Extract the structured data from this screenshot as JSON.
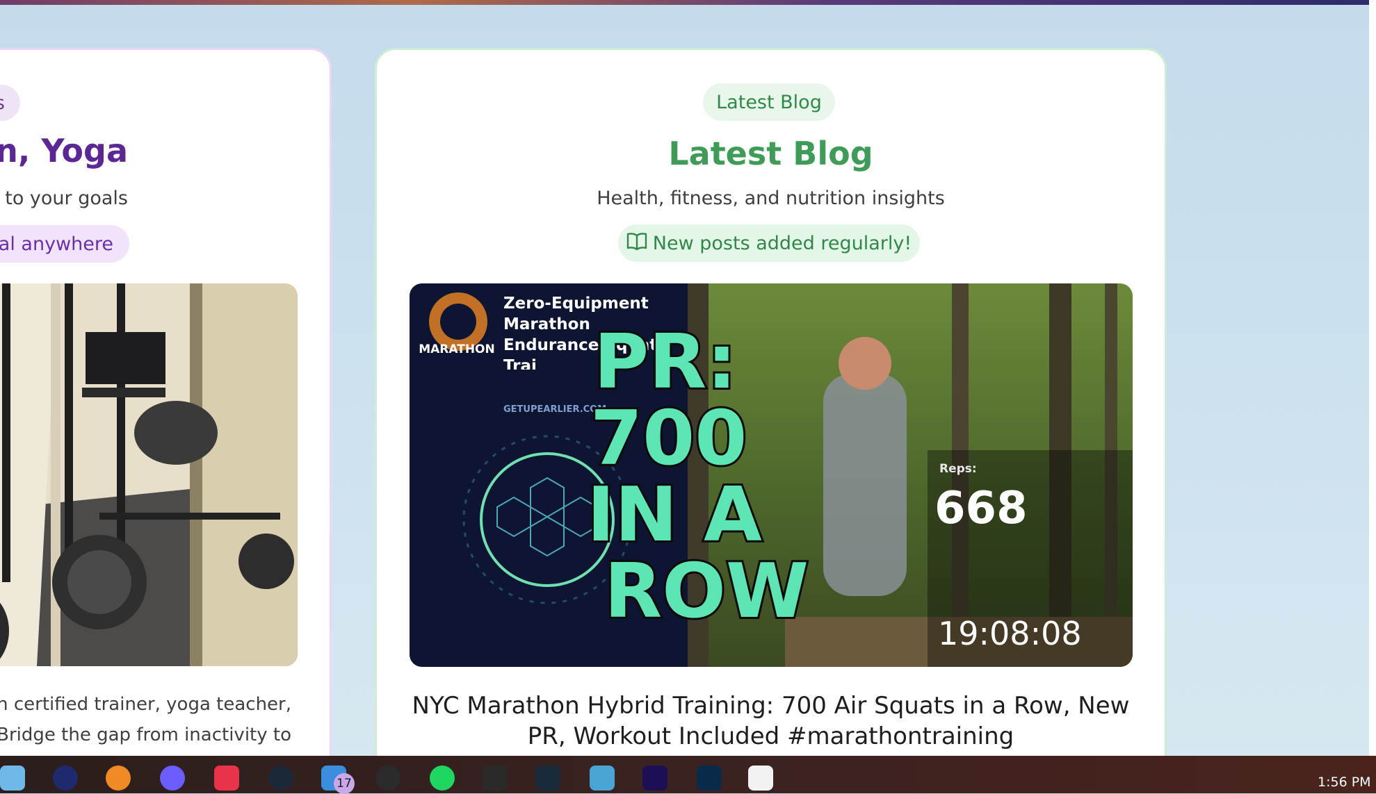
{
  "left_card": {
    "tag_partial": "s",
    "title_partial": "on, Yoga",
    "subtitle_partial": "d to your goals",
    "badge_partial": "ual anywhere",
    "body_line1_partial": "n certified trainer, yoga teacher,",
    "body_line2_partial": "Bridge the gap from inactivity to"
  },
  "right_card": {
    "tag": "Latest Blog",
    "title": "Latest Blog",
    "subtitle": "Health, fitness, and nutrition insights",
    "badge": "New posts added regularly!",
    "badge_icon": "book-open-icon",
    "post_image": {
      "heading": "Zero-Equipment Marathon Endurance Squat Trai",
      "logo_text": "MARATHON",
      "site_text": "GETUPEARLIER.COM",
      "overlay_lines": [
        "PR:",
        "700",
        "IN A",
        "ROW"
      ],
      "reps_label": "Reps:",
      "reps_value": "668",
      "timer": "19:08:08"
    },
    "post_title": "NYC Marathon Hybrid Training: 700 Air Squats in a Row, New PR, Workout Included #marathontraining"
  },
  "colors": {
    "background": "#c3dbeb",
    "left_accent": "#5c2696",
    "right_accent": "#3f9c58",
    "overlay_text": "#5ee5b4"
  },
  "taskbar": {
    "icons": [
      "notepad-icon",
      "browser-icon",
      "firefox-icon",
      "chat-icon",
      "creative-cloud-icon",
      "steam-icon",
      "mail-icon",
      "github-icon",
      "spotify-icon",
      "epic-games-icon",
      "app-icon",
      "user-icon",
      "premiere-icon",
      "photoshop-icon",
      "calendar-icon"
    ],
    "mail_badge": "17",
    "clock": "1:56 PM"
  }
}
